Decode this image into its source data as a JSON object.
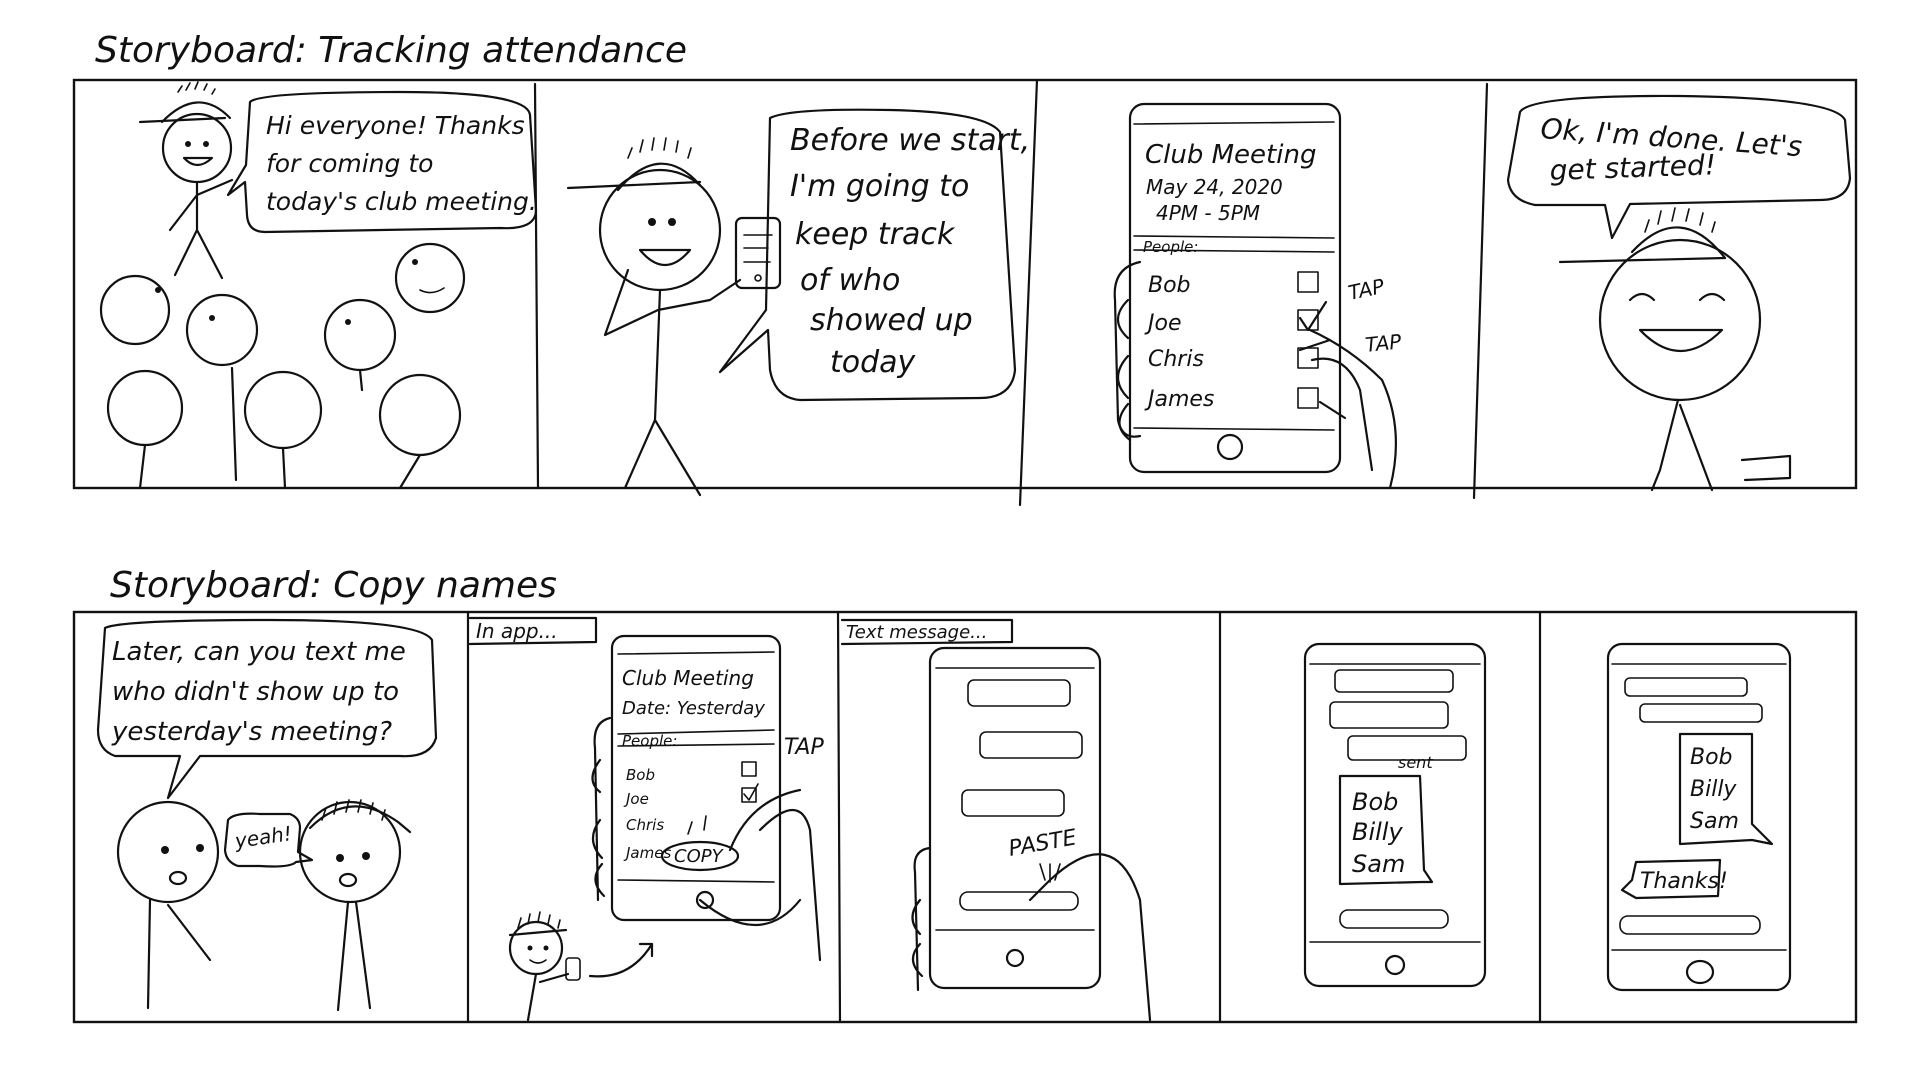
{
  "storyboard_1": {
    "title": "Storyboard: Tracking attendance",
    "panel_1": {
      "bubble_lines": [
        "Hi everyone! Thanks",
        "for coming to",
        "today's club meeting."
      ]
    },
    "panel_2": {
      "bubble_lines": [
        "Before we start,",
        "I'm going to",
        "keep track",
        "of who",
        "showed up",
        "today"
      ]
    },
    "panel_3": {
      "app_title": "Club Meeting",
      "date": "May 24, 2020",
      "time": "4PM - 5PM",
      "people_header": "People:",
      "people": [
        {
          "name": "Bob",
          "checked": false
        },
        {
          "name": "Joe",
          "checked": true
        },
        {
          "name": "Chris",
          "checked": false
        },
        {
          "name": "James",
          "checked": false
        }
      ],
      "tap_labels": [
        "TAP",
        "TAP"
      ]
    },
    "panel_4": {
      "bubble_lines": [
        "Ok, I'm done. Let's",
        "get started!"
      ]
    }
  },
  "storyboard_2": {
    "title": "Storyboard: Copy names",
    "panel_1": {
      "bubble_lines": [
        "Later, can you text me",
        "who didn't show up to",
        "yesterday's meeting?"
      ],
      "reply": "yeah!"
    },
    "panel_2": {
      "caption": "In app...",
      "app_title": "Club Meeting",
      "date": "Date: Yesterday",
      "people_header": "People:",
      "people": [
        "Bob",
        "Joe",
        "Chris",
        "James"
      ],
      "tap_label": "TAP",
      "copy_label": "COPY"
    },
    "panel_3": {
      "caption": "Text message...",
      "paste_label": "PASTE"
    },
    "panel_4": {
      "sent_label": "sent",
      "names": [
        "Bob",
        "Billy",
        "Sam"
      ]
    },
    "panel_5": {
      "names": [
        "Bob",
        "Billy",
        "Sam"
      ],
      "reply": "Thanks!"
    }
  }
}
